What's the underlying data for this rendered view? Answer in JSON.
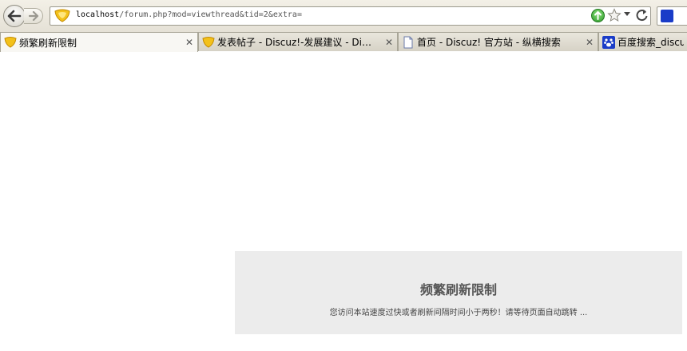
{
  "toolbar": {
    "url_host": "localhost",
    "url_path": "/forum.php?mod=viewthread&tid=2&extra="
  },
  "tabs": [
    {
      "title": "频繁刷新限制",
      "icon": "discuz-favicon-icon",
      "active": true
    },
    {
      "title": "发表帖子 - Discuz!-发展建议 - Di…",
      "icon": "discuz-favicon-icon",
      "active": false
    },
    {
      "title": "首页 - Discuz! 官方站 - 纵横搜索",
      "icon": "page-icon",
      "active": false
    },
    {
      "title": "百度搜索_discuz",
      "icon": "baidu-paw-icon",
      "active": false
    }
  ],
  "tab_close_symbol": "✕",
  "notice": {
    "title": "频繁刷新限制",
    "message": "您访问本站速度过快或者刷新间隔时间小于两秒！请等待页面自动跳转 ..."
  },
  "colors": {
    "notice_background": "#ececec",
    "toolbar_background": "#e5e1d6"
  }
}
